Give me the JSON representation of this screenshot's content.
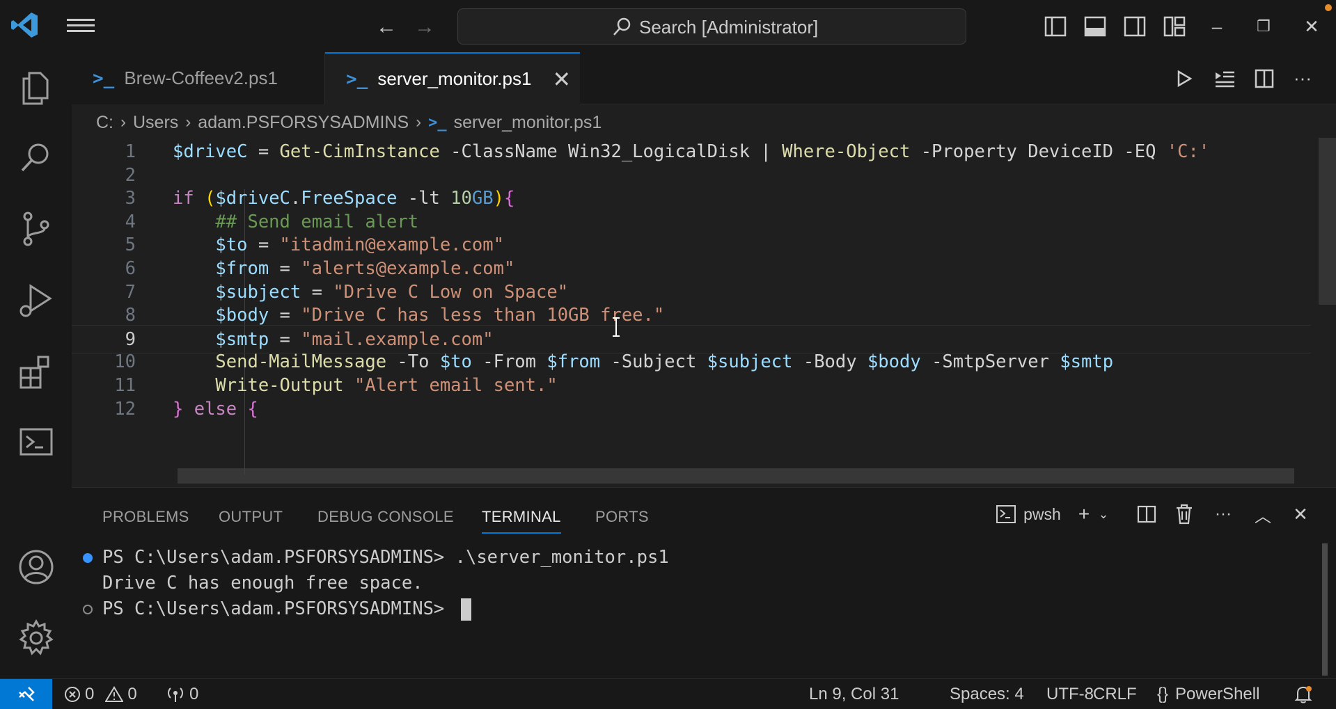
{
  "titlebar": {
    "search_label": "Search [Administrator]",
    "nav_back": "←",
    "nav_forward": "→"
  },
  "tabs": [
    {
      "label": "Brew-Coffeev2.ps1",
      "active": false
    },
    {
      "label": "server_monitor.ps1",
      "active": true
    }
  ],
  "breadcrumb": [
    "C:",
    "Users",
    "adam.PSFORSYSADMINS",
    "server_monitor.ps1"
  ],
  "editor": {
    "current_line": 9,
    "line_numbers": [
      "1",
      "2",
      "3",
      "4",
      "5",
      "6",
      "7",
      "8",
      "9",
      "10",
      "11",
      "12"
    ],
    "lines": [
      [
        [
          "var",
          "$driveC"
        ],
        [
          "txt",
          " = "
        ],
        [
          "cmd",
          "Get-CimInstance"
        ],
        [
          "txt",
          " -ClassName Win32_LogicalDisk | "
        ],
        [
          "cmd",
          "Where-Object"
        ],
        [
          "txt",
          " -Property DeviceID -EQ "
        ],
        [
          "str",
          "'C:'"
        ]
      ],
      [],
      [
        [
          "kw",
          "if"
        ],
        [
          "txt",
          " "
        ],
        [
          "brace",
          "("
        ],
        [
          "var",
          "$driveC"
        ],
        [
          "txt",
          "."
        ],
        [
          "var",
          "FreeSpace"
        ],
        [
          "txt",
          " -lt "
        ],
        [
          "num",
          "10"
        ],
        [
          "unit",
          "GB"
        ],
        [
          "brace",
          ")"
        ],
        [
          "brace2",
          "{"
        ]
      ],
      [
        [
          "txt",
          "    "
        ],
        [
          "com",
          "## Send email alert"
        ]
      ],
      [
        [
          "txt",
          "    "
        ],
        [
          "var",
          "$to"
        ],
        [
          "txt",
          " = "
        ],
        [
          "str",
          "\"itadmin@example.com\""
        ]
      ],
      [
        [
          "txt",
          "    "
        ],
        [
          "var",
          "$from"
        ],
        [
          "txt",
          " = "
        ],
        [
          "str",
          "\"alerts@example.com\""
        ]
      ],
      [
        [
          "txt",
          "    "
        ],
        [
          "var",
          "$subject"
        ],
        [
          "txt",
          " = "
        ],
        [
          "str",
          "\"Drive C Low on Space\""
        ]
      ],
      [
        [
          "txt",
          "    "
        ],
        [
          "var",
          "$body"
        ],
        [
          "txt",
          " = "
        ],
        [
          "str",
          "\"Drive C has less than 10GB free.\""
        ]
      ],
      [
        [
          "txt",
          "    "
        ],
        [
          "var",
          "$smtp"
        ],
        [
          "txt",
          " = "
        ],
        [
          "str",
          "\"mail.example.com\""
        ]
      ],
      [
        [
          "txt",
          "    "
        ],
        [
          "cmd",
          "Send-MailMessage"
        ],
        [
          "txt",
          " -To "
        ],
        [
          "var",
          "$to"
        ],
        [
          "txt",
          " -From "
        ],
        [
          "var",
          "$from"
        ],
        [
          "txt",
          " -Subject "
        ],
        [
          "var",
          "$subject"
        ],
        [
          "txt",
          " -Body "
        ],
        [
          "var",
          "$body"
        ],
        [
          "txt",
          " -SmtpServer "
        ],
        [
          "var",
          "$smtp"
        ]
      ],
      [
        [
          "txt",
          "    "
        ],
        [
          "cmd",
          "Write-Output"
        ],
        [
          "txt",
          " "
        ],
        [
          "str",
          "\"Alert email sent.\""
        ]
      ],
      [
        [
          "brace2",
          "}"
        ],
        [
          "txt",
          " "
        ],
        [
          "kw",
          "else"
        ],
        [
          "txt",
          " "
        ],
        [
          "brace2",
          "{"
        ]
      ]
    ]
  },
  "panel": {
    "tabs": [
      {
        "label": "PROBLEMS",
        "active": false
      },
      {
        "label": "OUTPUT",
        "active": false
      },
      {
        "label": "DEBUG CONSOLE",
        "active": false
      },
      {
        "label": "TERMINAL",
        "active": true
      },
      {
        "label": "PORTS",
        "active": false
      }
    ],
    "shell_label": "pwsh",
    "terminal": [
      {
        "dot": "filled",
        "text": "PS C:\\Users\\adam.PSFORSYSADMINS> .\\server_monitor.ps1"
      },
      {
        "dot": "none",
        "text": "Drive C has enough free space."
      },
      {
        "dot": "hollow",
        "text": "PS C:\\Users\\adam.PSFORSYSADMINS> "
      }
    ]
  },
  "statusbar": {
    "errors": "0",
    "warnings": "0",
    "ports": "0",
    "position": "Ln 9, Col 31",
    "spaces": "Spaces: 4",
    "encoding": "UTF-8",
    "eol": "CRLF",
    "language": "PowerShell"
  },
  "colors": {
    "accent": "#0078d4",
    "keyword": "#c586c0",
    "variable": "#9cdcfe",
    "command": "#dcdcaa",
    "string": "#ce9178",
    "comment": "#6a9955"
  }
}
